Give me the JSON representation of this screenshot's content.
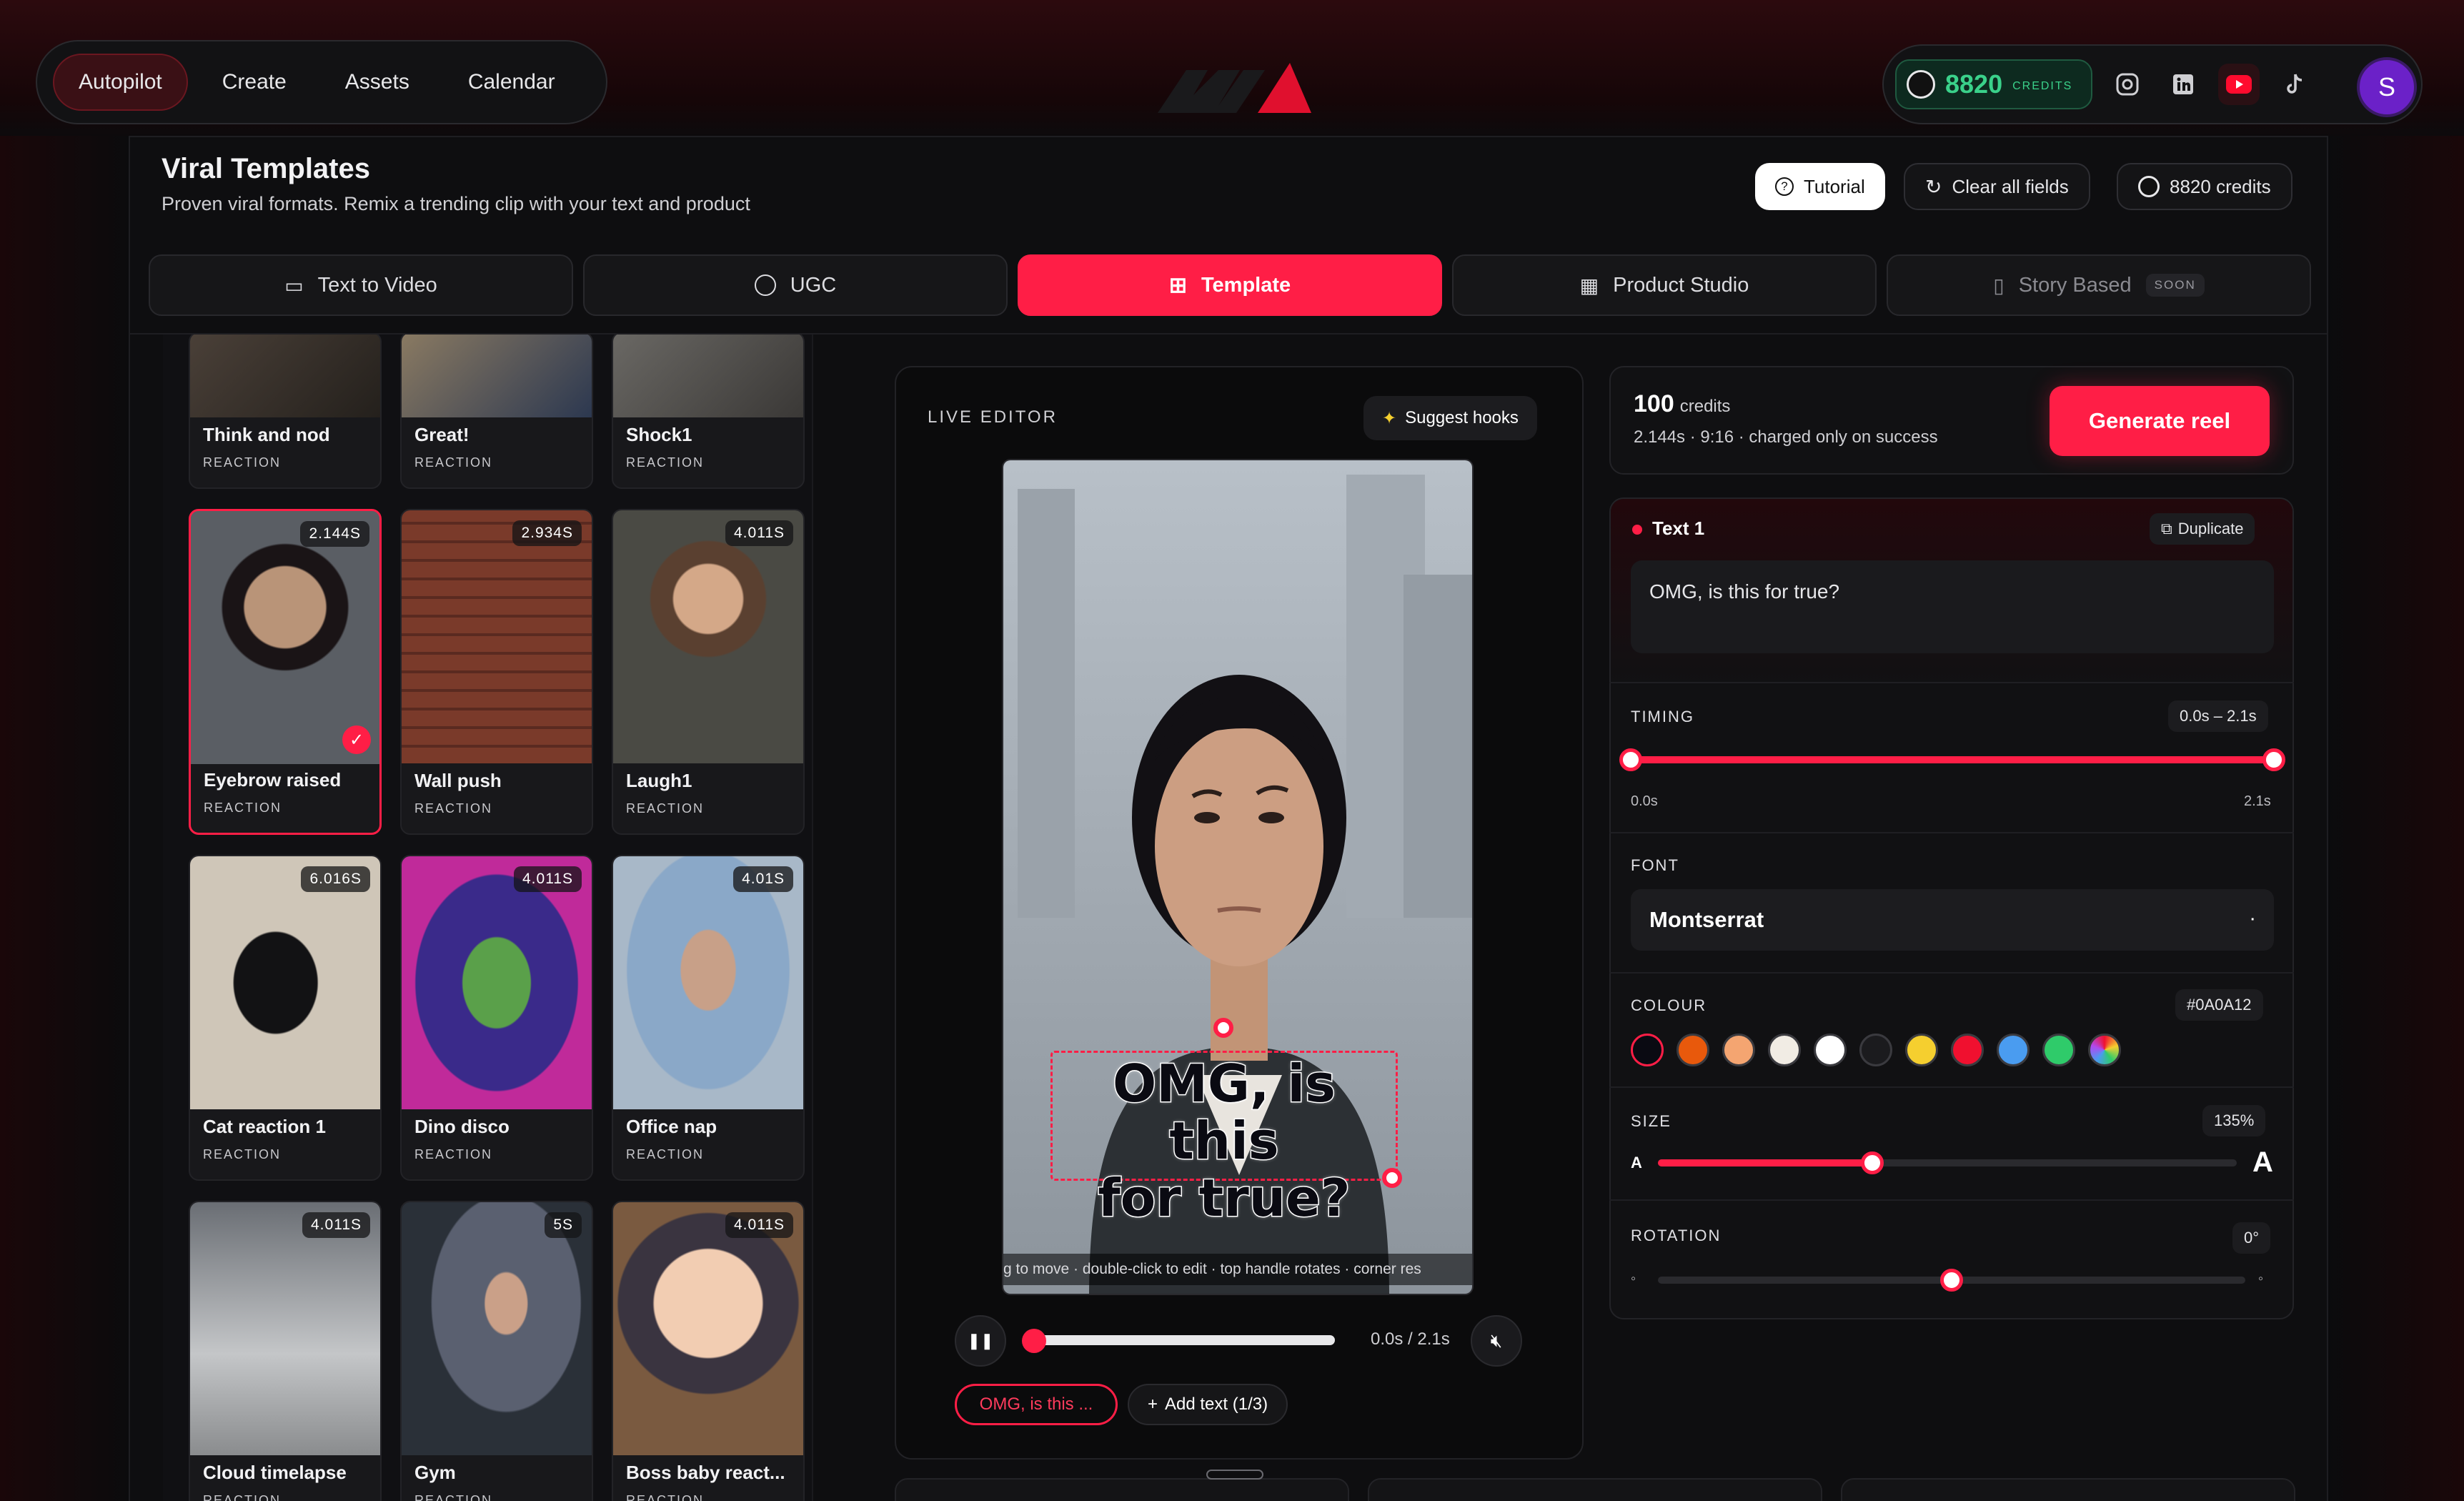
{
  "nav": {
    "items": [
      "Autopilot",
      "Create",
      "Assets",
      "Calendar"
    ],
    "active": "Autopilot"
  },
  "account": {
    "credits": "8820",
    "credits_label": "CREDITS",
    "avatar_initial": "S"
  },
  "header": {
    "title": "Viral Templates",
    "subtitle": "Proven viral formats. Remix a trending clip with your text and product",
    "tutorial": "Tutorial",
    "clear": "Clear all fields",
    "credits": "8820 credits"
  },
  "tabs": [
    {
      "label": "Text to Video"
    },
    {
      "label": "UGC"
    },
    {
      "label": "Template",
      "active": true
    },
    {
      "label": "Product Studio"
    },
    {
      "label": "Story Based",
      "badge": "SOON"
    }
  ],
  "templates": [
    {
      "name": "Think and nod",
      "category": "REACTION"
    },
    {
      "name": "Great!",
      "category": "REACTION"
    },
    {
      "name": "Shock1",
      "category": "REACTION"
    },
    {
      "name": "Eyebrow raised",
      "category": "REACTION",
      "duration": "2.144S",
      "selected": true
    },
    {
      "name": "Wall push",
      "category": "REACTION",
      "duration": "2.934S"
    },
    {
      "name": "Laugh1",
      "category": "REACTION",
      "duration": "4.011S"
    },
    {
      "name": "Cat reaction 1",
      "category": "REACTION",
      "duration": "6.016S"
    },
    {
      "name": "Dino disco",
      "category": "REACTION",
      "duration": "4.011S"
    },
    {
      "name": "Office nap",
      "category": "REACTION",
      "duration": "4.01S"
    },
    {
      "name": "Cloud timelapse",
      "category": "REACTION",
      "duration": "4.011S"
    },
    {
      "name": "Gym",
      "category": "REACTION",
      "duration": "5S"
    },
    {
      "name": "Boss baby react...",
      "category": "REACTION",
      "duration": "4.011S"
    }
  ],
  "editor": {
    "label": "LIVE EDITOR",
    "suggest": "Suggest hooks",
    "overlay_line1": "OMG, is this",
    "overlay_line2": "for true?",
    "hint": "g to move · double-click to edit · top handle rotates · corner res",
    "time": "0.0s / 2.1s",
    "progress": 0.0,
    "chip": "OMG, is this ...",
    "add_text": "Add text (1/3)"
  },
  "generate": {
    "credits": "100",
    "credits_unit": "credits",
    "meta": "2.144s · 9:16 · charged only on success",
    "button": "Generate reel"
  },
  "text_layer": {
    "title": "Text 1",
    "duplicate": "Duplicate",
    "value": "OMG, is this for true?"
  },
  "timing": {
    "label": "TIMING",
    "range": "0.0s – 2.1s",
    "start": "0.0s",
    "end": "2.1s"
  },
  "font": {
    "label": "FONT",
    "value": "Montserrat",
    "caret": "·"
  },
  "colour": {
    "label": "COLOUR",
    "hex": "#0A0A12",
    "swatches": [
      "#0a0a12",
      "#e8590c",
      "#f4a571",
      "#f1ece4",
      "#ffffff",
      "#1b1b1e",
      "#f5cf2f",
      "#f0102f",
      "#4a9cf0",
      "#2fcb6a",
      "conic"
    ]
  },
  "size": {
    "label": "SIZE",
    "value": "135%",
    "min_glyph": "A",
    "max_glyph": "A",
    "level": 0.37
  },
  "rotation": {
    "label": "ROTATION",
    "value": "0°",
    "level": 0.5
  }
}
